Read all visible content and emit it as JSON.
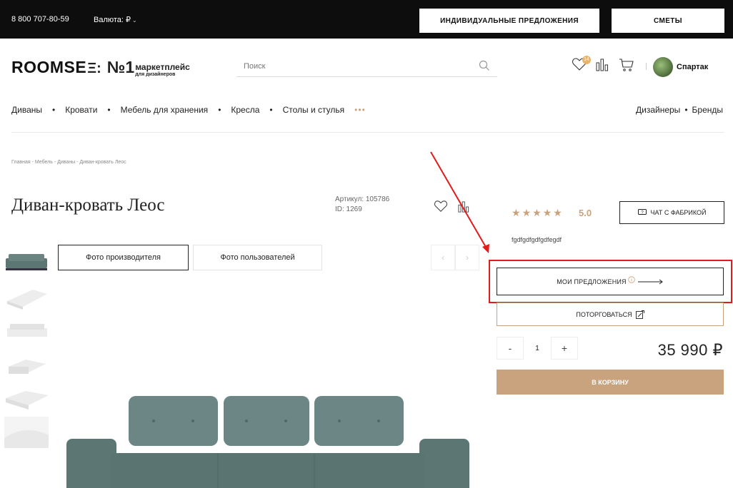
{
  "topbar": {
    "phone": "8 800 707-80-59",
    "currency_label": "Валюта: ₽",
    "offers_button": "ИНДИВИДУАЛЬНЫЕ ПРЕДЛОЖЕНИЯ",
    "estimates_button": "СМЕТЫ"
  },
  "header": {
    "logo_brand": "ROOMSE",
    "logo_eq": "Ξ:",
    "logo_no1": "№1",
    "logo_tag1": "маркетплейс",
    "logo_tag2": "для дизайнеров",
    "search_placeholder": "Поиск",
    "favorites_badge": "14",
    "user_name": "Спартак"
  },
  "catnav": {
    "items": [
      "Диваны",
      "Кровати",
      "Мебель для хранения",
      "Кресла",
      "Столы и стулья"
    ],
    "more": "•••",
    "right_items": [
      "Дизайнеры",
      "Бренды"
    ]
  },
  "breadcrumb": "Главная - Мебель - Диваны - Диван-кровать Леос",
  "product": {
    "title": "Диван-кровать Леос",
    "sku": "Артикул: 105786",
    "id": "ID: 1269",
    "rating": "5.0",
    "rating_stars": 5,
    "chat_button": "ЧАТ С ФАБРИКОЙ",
    "subtitle": "fgdfgdfgdfgdfegdf",
    "my_offers_button": "МОИ ПРЕДЛОЖЕНИЯ",
    "bargain_button": "ПОТОРГОВАТЬСЯ",
    "qty_minus": "-",
    "qty_value": "1",
    "qty_plus": "+",
    "price": "35 990 ₽",
    "cart_button": "В КОРЗИНУ"
  },
  "gallery": {
    "tab_manufacturer": "Фото производителя",
    "tab_users": "Фото пользователей",
    "prev": "‹",
    "next": "›",
    "sofa_color": "#5c7674",
    "thumb_count": 6
  },
  "colors": {
    "accent": "#c9a27e",
    "annotation_red": "#e21b1b",
    "topbar_bg": "#0d0d0d"
  }
}
